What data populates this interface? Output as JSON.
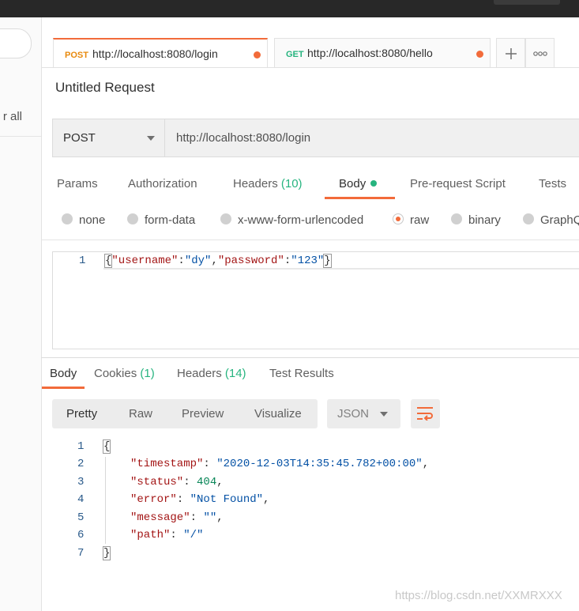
{
  "tabs": [
    {
      "method": "POST",
      "method_color": "#e8890c",
      "url": "http://localhost:8080/login",
      "active": true
    },
    {
      "method": "GET",
      "method_color": "#26b47f",
      "url": "http://localhost:8080/hello",
      "active": false
    }
  ],
  "sidebar": {
    "clear_all_fragment": "r all"
  },
  "request": {
    "title": "Untitled Request",
    "method": "POST",
    "url": "http://localhost:8080/login",
    "tabs": {
      "params": "Params",
      "authorization": "Authorization",
      "headers": "Headers",
      "headers_count": "(10)",
      "body": "Body",
      "prerequest": "Pre-request Script",
      "tests": "Tests"
    },
    "body_types": {
      "none": "none",
      "form_data": "form-data",
      "urlencoded": "x-www-form-urlencoded",
      "raw": "raw",
      "binary": "binary",
      "graphql": "GraphQ"
    },
    "selected_body_type": "raw",
    "body_line_number": "1",
    "body": {
      "open": "{",
      "k1": "\"username\"",
      "colon": ":",
      "v1": "\"dy\"",
      "comma": ",",
      "k2": "\"password\"",
      "v2": "\"123\"",
      "close": "}"
    }
  },
  "response": {
    "tabs": {
      "body": "Body",
      "cookies": "Cookies",
      "cookies_count": "(1)",
      "headers": "Headers",
      "headers_count": "(14)",
      "test_results": "Test Results"
    },
    "views": {
      "pretty": "Pretty",
      "raw": "Raw",
      "preview": "Preview",
      "visualize": "Visualize"
    },
    "active_view": "Pretty",
    "format": "JSON",
    "line_numbers": [
      "1",
      "2",
      "3",
      "4",
      "5",
      "6",
      "7"
    ],
    "json": {
      "open": "{",
      "timestamp_key": "\"timestamp\"",
      "timestamp_value": "\"2020-12-03T14:35:45.782+00:00\"",
      "status_key": "\"status\"",
      "status_value": "404",
      "error_key": "\"error\"",
      "error_value": "\"Not Found\"",
      "message_key": "\"message\"",
      "message_value": "\"\"",
      "path_key": "\"path\"",
      "path_value": "\"/\"",
      "close": "}"
    }
  },
  "watermark": "https://blog.csdn.net/XXMRXXX",
  "colors": {
    "accent": "#f26b3a",
    "count_green": "#26b47f",
    "post_orange": "#e8890c",
    "json_key": "#a31515",
    "json_string": "#0451a5",
    "json_number": "#098658"
  },
  "icons": {
    "plus_tab": "plus-icon",
    "more_tabs": "more-icon",
    "wrap": "wrap-lines-icon"
  }
}
